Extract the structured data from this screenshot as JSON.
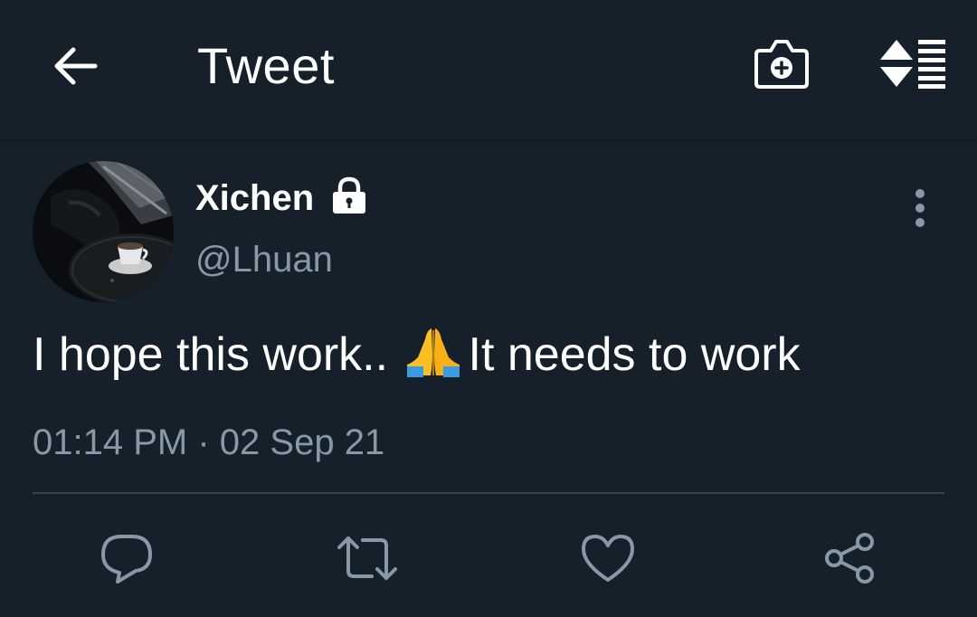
{
  "header": {
    "title": "Tweet",
    "icons": {
      "back": "arrow-left-icon",
      "camera": "camera-add-icon",
      "sort": "sort-thread-icon"
    }
  },
  "tweet": {
    "author": {
      "name": "Xichen",
      "handle": "@Lhuan",
      "protected": true
    },
    "text_before_emoji": "I hope this work..",
    "emoji": "folded-hands",
    "text_after_emoji": "It needs to work",
    "time": "01:14 PM",
    "separator": "·",
    "date": "02 Sep 21"
  },
  "actions": [
    "reply-icon",
    "retweet-icon",
    "like-icon",
    "share-icon"
  ],
  "colors": {
    "background": "#15202b",
    "text_primary": "#ffffff",
    "text_secondary": "#8899a6",
    "divider": "#38444d"
  }
}
